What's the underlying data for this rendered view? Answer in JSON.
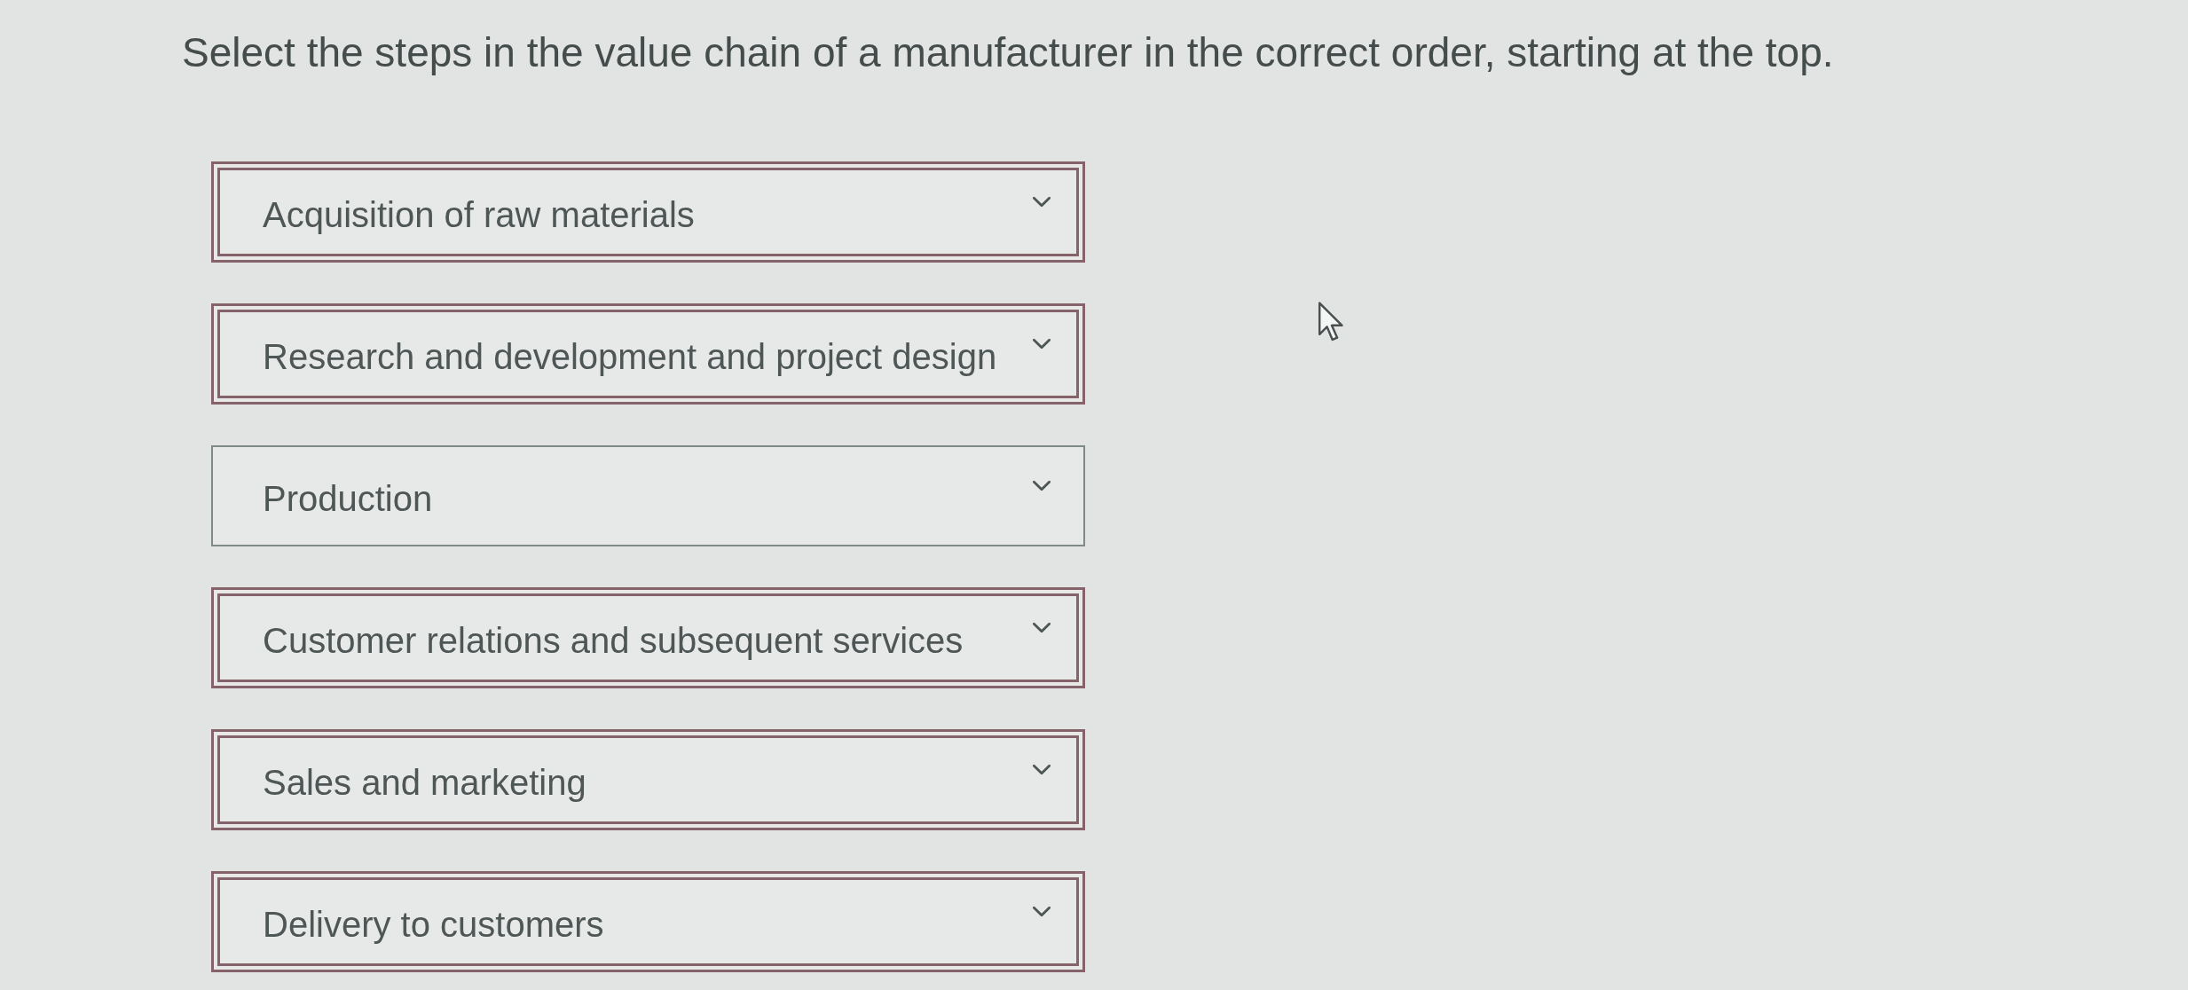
{
  "question": {
    "text": "Select the steps in the value chain of a manufacturer in the correct order, starting at the top."
  },
  "dropdowns": [
    {
      "value": "Acquisition of raw materials",
      "highlighted": true
    },
    {
      "value": "Research and development and project design",
      "highlighted": true
    },
    {
      "value": "Production",
      "highlighted": false
    },
    {
      "value": "Customer relations and subsequent services",
      "highlighted": true
    },
    {
      "value": "Sales and marketing",
      "highlighted": true
    },
    {
      "value": "Delivery to customers",
      "highlighted": true
    }
  ]
}
